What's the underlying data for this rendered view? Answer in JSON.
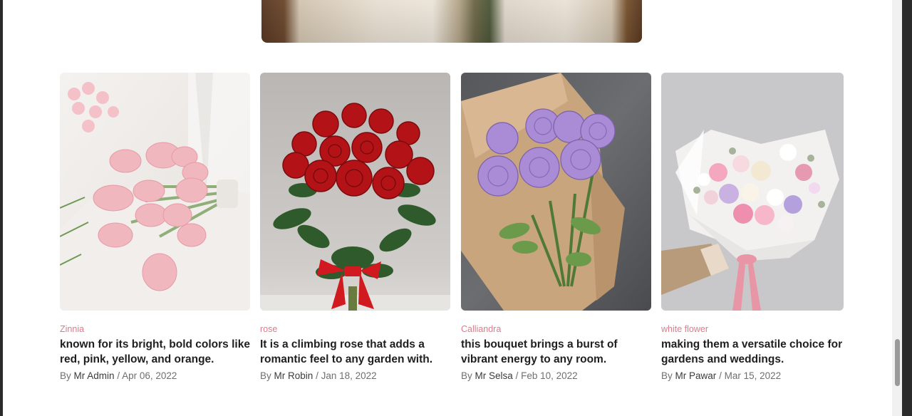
{
  "posts": [
    {
      "category": "Zinnia",
      "title": "known for its bright, bold colors like red, pink, yellow, and orange.",
      "by": "By",
      "author": "Mr Admin",
      "date": "Apr 06, 2022",
      "image": "pink-tulips-bouquet"
    },
    {
      "category": "rose",
      "title": "It is a climbing rose that adds a romantic feel to any garden with.",
      "by": "By",
      "author": "Mr Robin",
      "date": "Jan 18, 2022",
      "image": "red-roses-bouquet"
    },
    {
      "category": "Calliandra",
      "title": "this bouquet brings a burst of vibrant energy to any room.",
      "by": "By",
      "author": "Mr Selsa",
      "date": "Feb 10, 2022",
      "image": "purple-roses-bouquet"
    },
    {
      "category": "white flower",
      "title": "making them a versatile choice for gardens and weddings.",
      "by": "By",
      "author": "Mr Pawar",
      "date": "Mar 15, 2022",
      "image": "pastel-mixed-bouquet"
    }
  ],
  "colors": {
    "category": "#e07a8a",
    "title": "#1f1f1f",
    "meta": "#6f6f6f"
  }
}
